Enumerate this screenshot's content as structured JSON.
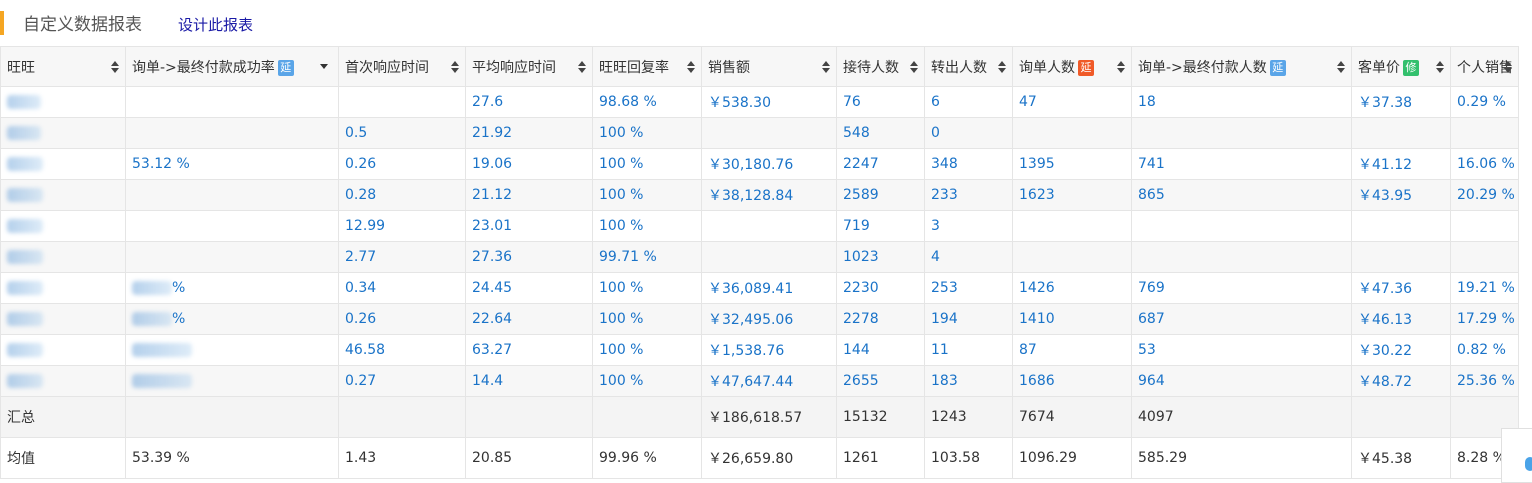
{
  "header": {
    "title": "自定义数据报表",
    "design_link": "设计此报表",
    "accent_color": "#f5a623"
  },
  "table": {
    "columns": [
      {
        "label": "旺旺",
        "badge": null
      },
      {
        "label": "询单->最终付款成功率",
        "badge": {
          "text": "延",
          "color": "#5aa5e8"
        }
      },
      {
        "label": "首次响应时间",
        "badge": null
      },
      {
        "label": "平均响应时间",
        "badge": null
      },
      {
        "label": "旺旺回复率",
        "badge": null
      },
      {
        "label": "销售额",
        "badge": null
      },
      {
        "label": "接待人数",
        "badge": null
      },
      {
        "label": "转出人数",
        "badge": null
      },
      {
        "label": "询单人数",
        "badge": {
          "text": "延",
          "color": "#f05a28"
        }
      },
      {
        "label": "询单->最终付款人数",
        "badge": {
          "text": "延",
          "color": "#5aa5e8"
        }
      },
      {
        "label": "客单价",
        "badge": {
          "text": "修",
          "color": "#33c06d"
        }
      },
      {
        "label": "个人销售",
        "badge": null
      }
    ],
    "rows": [
      [
        "",
        "",
        "",
        "27.6",
        "98.68 %",
        "￥538.30",
        "76",
        "6",
        "47",
        "18",
        "￥37.38",
        "0.29 %"
      ],
      [
        "",
        "",
        "0.5",
        "21.92",
        "100 %",
        "",
        "548",
        "0",
        "",
        "",
        "",
        ""
      ],
      [
        "",
        "53.12 %",
        "0.26",
        "19.06",
        "100 %",
        "￥30,180.76",
        "2247",
        "348",
        "1395",
        "741",
        "￥41.12",
        "16.06 %"
      ],
      [
        "",
        "",
        "0.28",
        "21.12",
        "100 %",
        "￥38,128.84",
        "2589",
        "233",
        "1623",
        "865",
        "￥43.95",
        "20.29 %"
      ],
      [
        "",
        "",
        "12.99",
        "23.01",
        "100 %",
        "",
        "719",
        "3",
        "",
        "",
        "",
        ""
      ],
      [
        "",
        "",
        "2.77",
        "27.36",
        "99.71 %",
        "",
        "1023",
        "4",
        "",
        "",
        "",
        ""
      ],
      [
        "",
        "%",
        "0.34",
        "24.45",
        "100 %",
        "￥36,089.41",
        "2230",
        "253",
        "1426",
        "769",
        "￥47.36",
        "19.21 %"
      ],
      [
        "",
        "%",
        "0.26",
        "22.64",
        "100 %",
        "￥32,495.06",
        "2278",
        "194",
        "1410",
        "687",
        "￥46.13",
        "17.29 %"
      ],
      [
        "",
        "",
        "46.58",
        "63.27",
        "100 %",
        "￥1,538.76",
        "144",
        "11",
        "87",
        "53",
        "￥30.22",
        "0.82 %"
      ],
      [
        "",
        "",
        "0.27",
        "14.4",
        "100 %",
        "￥47,647.44",
        "2655",
        "183",
        "1686",
        "964",
        "￥48.72",
        "25.36 %"
      ]
    ],
    "summary": [
      "汇总",
      "",
      "",
      "",
      "",
      "￥186,618.57",
      "15132",
      "1243",
      "7674",
      "4097",
      "",
      ""
    ],
    "average": [
      "均值",
      "53.39 %",
      "1.43",
      "20.85",
      "99.96 %",
      "￥26,659.80",
      "1261",
      "103.58",
      "1096.29",
      "585.29",
      "￥45.38",
      "8.28 %"
    ]
  },
  "colors": {
    "value_text": "#1a73c8",
    "link": "#1a1aa6"
  }
}
